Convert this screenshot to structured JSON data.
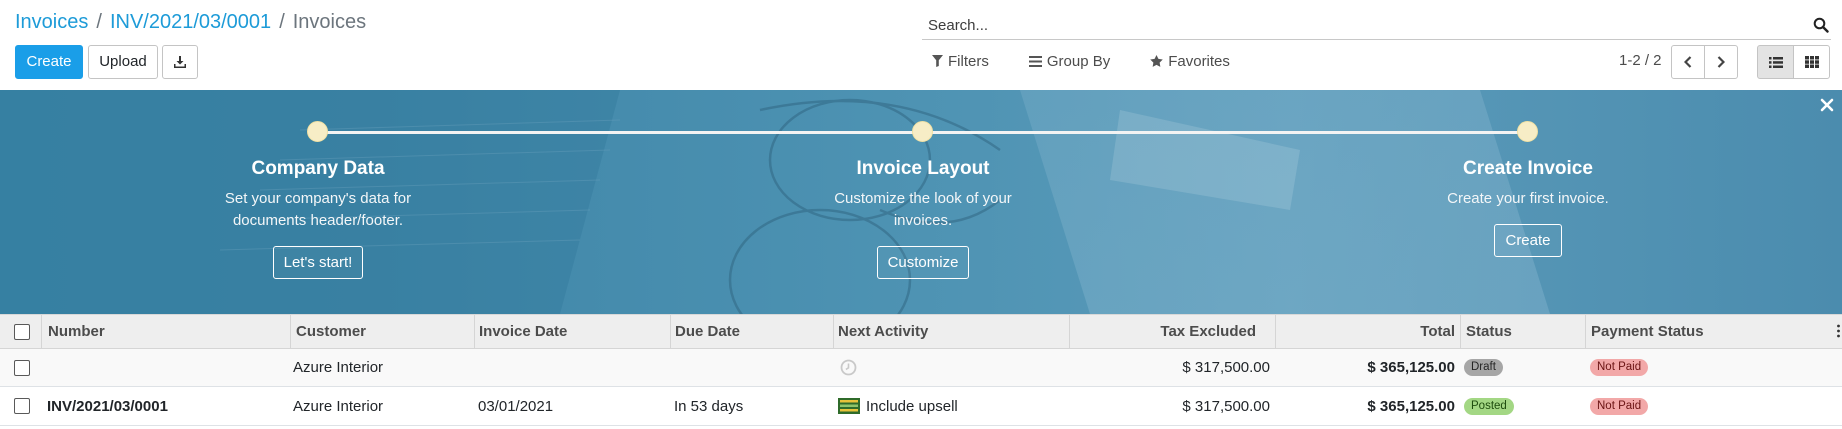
{
  "breadcrumb": {
    "items": [
      "Invoices",
      "INV/2021/03/0001"
    ],
    "separator": "/",
    "current": "Invoices"
  },
  "toolbar": {
    "create_label": "Create",
    "upload_label": "Upload",
    "download_icon": "download-icon"
  },
  "search": {
    "placeholder": "Search...",
    "filters_label": "Filters",
    "group_by_label": "Group By",
    "favorites_label": "Favorites"
  },
  "pager": {
    "value": "1-2 / 2"
  },
  "views": {
    "active": "list",
    "options": [
      "list",
      "kanban"
    ]
  },
  "onboarding": {
    "steps": [
      {
        "title": "Company Data",
        "description_line1": "Set your company's data for",
        "description_line2": "documents header/footer.",
        "button": "Let's start!"
      },
      {
        "title": "Invoice Layout",
        "description_line1": "Customize the look of your",
        "description_line2": "invoices.",
        "button": "Customize"
      },
      {
        "title": "Create Invoice",
        "description_line1": "Create your first invoice.",
        "description_line2": "",
        "button": "Create"
      }
    ],
    "close_icon": "close-icon"
  },
  "table": {
    "columns": [
      "Number",
      "Customer",
      "Invoice Date",
      "Due Date",
      "Next Activity",
      "Tax Excluded",
      "Total",
      "Status",
      "Payment Status"
    ],
    "rows": [
      {
        "number": "",
        "customer": "Azure Interior",
        "invoice_date": "",
        "due_date": "",
        "next_activity": "",
        "activity_icon": "clock-icon",
        "tax_excluded": "$ 317,500.00",
        "total": "$ 365,125.00",
        "status": "Draft",
        "payment_status": "Not Paid"
      },
      {
        "number": "INV/2021/03/0001",
        "customer": "Azure Interior",
        "invoice_date": "03/01/2021",
        "due_date": "In 53 days",
        "next_activity": "Include upsell",
        "activity_icon": "upsell-icon",
        "tax_excluded": "$ 317,500.00",
        "total": "$ 365,125.00",
        "status": "Posted",
        "payment_status": "Not Paid"
      }
    ]
  },
  "colors": {
    "primary": "#1a9ee8",
    "link": "#1d9bd8",
    "banner": "#4e93b3",
    "draft": "#a6a6a6",
    "posted": "#a3d784",
    "not_paid": "#f2a8a8"
  }
}
